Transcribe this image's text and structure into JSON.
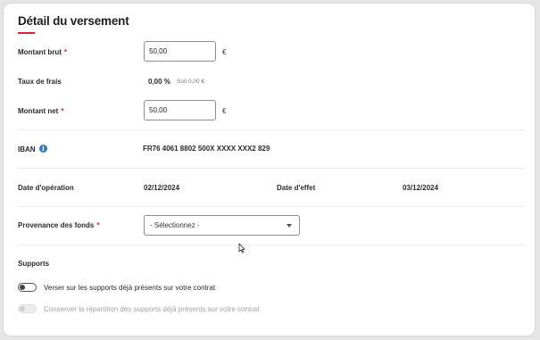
{
  "page_title": "Détail du versement",
  "required_marker": "*",
  "montant_brut": {
    "label": "Montant brut",
    "value": "50,00",
    "unit": "€"
  },
  "taux_frais": {
    "label": "Taux de frais",
    "value": "0,00 %",
    "note": "Soit 0,00 €"
  },
  "montant_net": {
    "label": "Montant net",
    "value": "50,00",
    "unit": "€"
  },
  "iban": {
    "label": "IBAN",
    "info_icon_glyph": "i",
    "value": "FR76 4061 8802 500X XXXX XXX2 829"
  },
  "dates": {
    "operation_label": "Date d'opération",
    "operation_value": "02/12/2024",
    "effet_label": "Date d'effet",
    "effet_value": "03/12/2024"
  },
  "provenance": {
    "label": "Provenance des fonds",
    "selected": "- Sélectionnez -"
  },
  "supports": {
    "title": "Supports",
    "toggle_1": {
      "label": "Verser sur les supports déjà présents sur votre contrat",
      "state": "off",
      "enabled": true
    },
    "toggle_2": {
      "label": "Conserver la répartition des supports déjà présents sur votre contrat",
      "state": "off",
      "enabled": false
    }
  },
  "colors": {
    "accent": "#d7262f",
    "info": "#2d7bc8"
  },
  "icons": {
    "info": "info-icon",
    "dropdown": "chevron-down-icon",
    "cursor": "mouse-pointer-icon"
  }
}
